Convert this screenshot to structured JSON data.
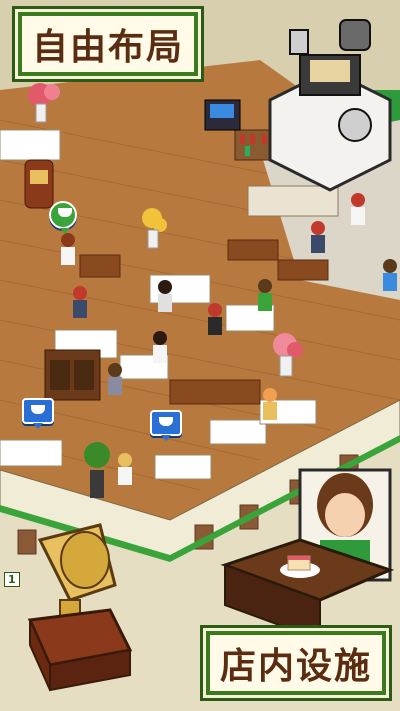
{
  "banners": {
    "top_title": "自由布局",
    "bottom_title": "店内设施"
  },
  "hud": {
    "level_number": "1"
  },
  "icons": {
    "order_bubble": "coffee-cup-icon",
    "customer_bubble": "customer-icon"
  },
  "colors": {
    "border_green": "#2e9a3c",
    "banner_text": "#5a2d12",
    "banner_bg": "#fffbe8",
    "floor_wood": "#b8793e",
    "wall_cream": "#f1ecd6",
    "bubble_blue": "#2a6fd6"
  }
}
